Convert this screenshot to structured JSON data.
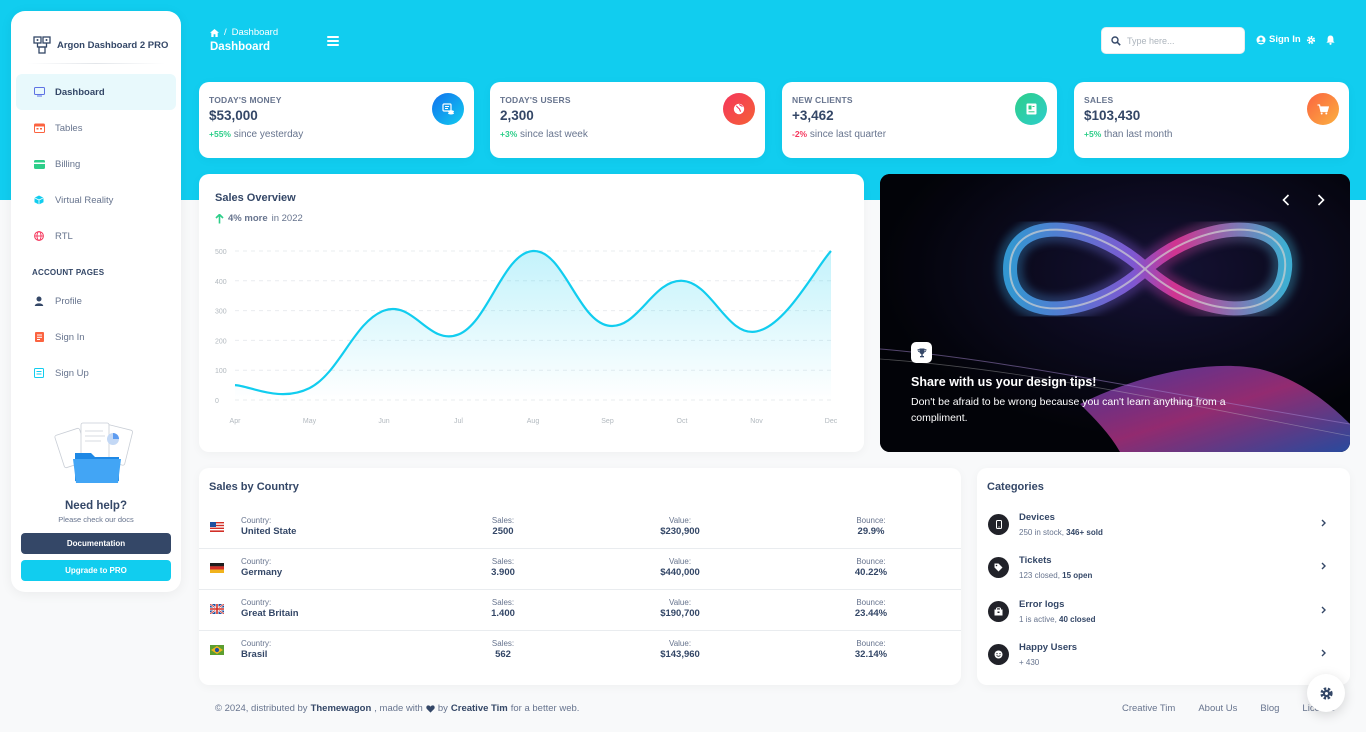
{
  "brand": {
    "name": "Argon Dashboard 2 PRO"
  },
  "sidebar": {
    "items": [
      {
        "label": "Dashboard",
        "icon": "tv-icon",
        "color": "#5e72e4",
        "active": true
      },
      {
        "label": "Tables",
        "icon": "calendar-icon",
        "color": "#fb6340"
      },
      {
        "label": "Billing",
        "icon": "credit-card-icon",
        "color": "#2dce89"
      },
      {
        "label": "Virtual Reality",
        "icon": "app-icon",
        "color": "#11cdef"
      },
      {
        "label": "RTL",
        "icon": "world-icon",
        "color": "#f5365c"
      }
    ],
    "section_title": "ACCOUNT PAGES",
    "account_items": [
      {
        "label": "Profile",
        "icon": "user-icon",
        "color": "#344767"
      },
      {
        "label": "Sign In",
        "icon": "document-icon",
        "color": "#fb6340"
      },
      {
        "label": "Sign Up",
        "icon": "collection-icon",
        "color": "#11cdef"
      }
    ],
    "help": {
      "title": "Need help?",
      "subtitle": "Please check our docs",
      "doc_button": "Documentation",
      "pro_button": "Upgrade to PRO"
    }
  },
  "header": {
    "breadcrumb_current": "Dashboard",
    "title": "Dashboard",
    "search_placeholder": "Type here...",
    "signin_label": "Sign In"
  },
  "stats": [
    {
      "label": "TODAY'S MONEY",
      "value": "$53,000",
      "change": "+55%",
      "trend": "up",
      "period": "since yesterday",
      "icon": "money-coins-icon",
      "color": "#1a73e8"
    },
    {
      "label": "TODAY'S USERS",
      "value": "2,300",
      "change": "+3%",
      "trend": "up",
      "period": "since last week",
      "icon": "world-icon",
      "color": "#f5365c"
    },
    {
      "label": "NEW CLIENTS",
      "value": "+3,462",
      "change": "-2%",
      "trend": "down",
      "period": "since last quarter",
      "icon": "paper-diploma-icon",
      "color": "#2dce89"
    },
    {
      "label": "SALES",
      "value": "$103,430",
      "change": "+5%",
      "trend": "up",
      "period": "than last month",
      "icon": "cart-icon",
      "color": "#fb6340"
    }
  ],
  "overview": {
    "title": "Sales Overview",
    "sub_bold": "4% more",
    "sub_rest": "in 2022"
  },
  "chart_data": {
    "type": "line",
    "categories": [
      "Apr",
      "May",
      "Jun",
      "Jul",
      "Aug",
      "Sep",
      "Oct",
      "Nov",
      "Dec"
    ],
    "series": [
      {
        "values": [
          50,
          40,
          300,
          220,
          500,
          250,
          400,
          230,
          500
        ],
        "color": "#11cdef"
      }
    ],
    "ylim": [
      0,
      500
    ],
    "yticks": [
      0,
      100,
      200,
      300,
      400,
      500
    ],
    "grid": true,
    "fill": "gradient"
  },
  "carousel": {
    "title": "Share with us your design tips!",
    "text": "Don't be afraid to be wrong because you can't learn anything from a compliment."
  },
  "countries": {
    "title": "Sales by Country",
    "labels": {
      "country": "Country:",
      "sales": "Sales:",
      "value": "Value:",
      "bounce": "Bounce:"
    },
    "rows": [
      {
        "flag": "us-flag",
        "country": "United State",
        "sales": "2500",
        "value": "$230,900",
        "bounce": "29.9%"
      },
      {
        "flag": "de-flag",
        "country": "Germany",
        "sales": "3.900",
        "value": "$440,000",
        "bounce": "40.22%"
      },
      {
        "flag": "gb-flag",
        "country": "Great Britain",
        "sales": "1.400",
        "value": "$190,700",
        "bounce": "23.44%"
      },
      {
        "flag": "br-flag",
        "country": "Brasil",
        "sales": "562",
        "value": "$143,960",
        "bounce": "32.14%"
      }
    ]
  },
  "categories": {
    "title": "Categories",
    "items": [
      {
        "name": "Devices",
        "desc": "250 in stock, ",
        "desc_bold": "346+ sold",
        "icon": "mobile-icon"
      },
      {
        "name": "Tickets",
        "desc": "123 closed, ",
        "desc_bold": "15 open",
        "icon": "tag-icon"
      },
      {
        "name": "Error logs",
        "desc": "1 is active, ",
        "desc_bold": "40 closed",
        "icon": "box-icon"
      },
      {
        "name": "Happy Users",
        "desc": "+ 430",
        "desc_bold": "",
        "icon": "smile-icon"
      }
    ]
  },
  "footer": {
    "prefix": "© 2024, distributed by",
    "distributor": "Themewagon",
    "made_with": ", made with",
    "by": "by",
    "author": "Creative Tim",
    "suffix": "for a better web.",
    "links": [
      "Creative Tim",
      "About Us",
      "Blog",
      "License"
    ]
  }
}
